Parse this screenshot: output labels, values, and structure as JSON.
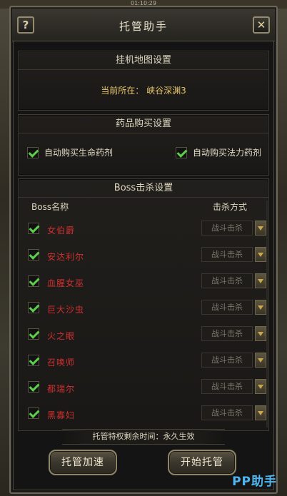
{
  "status": {
    "time": "01:10:29"
  },
  "header": {
    "title": "托管助手",
    "help_label": "?",
    "close_label": "✕"
  },
  "map_section": {
    "title": "挂机地图设置",
    "current_label": "当前所在：",
    "current_map": "峡谷深渊3"
  },
  "medicine_section": {
    "title": "药品购买设置",
    "options": [
      {
        "label": "自动购买生命药剂",
        "checked": true
      },
      {
        "label": "自动购买法力药剂",
        "checked": true
      }
    ]
  },
  "boss_section": {
    "title": "Boss击杀设置",
    "col_name": "Boss名称",
    "col_method": "击杀方式",
    "bosses": [
      {
        "name": "女伯爵",
        "checked": true,
        "method": "战斗击杀"
      },
      {
        "name": "安达利尔",
        "checked": true,
        "method": "战斗击杀"
      },
      {
        "name": "血腥女巫",
        "checked": true,
        "method": "战斗击杀"
      },
      {
        "name": "巨大沙虫",
        "checked": true,
        "method": "战斗击杀"
      },
      {
        "name": "火之眼",
        "checked": true,
        "method": "战斗击杀"
      },
      {
        "name": "召唤师",
        "checked": true,
        "method": "战斗击杀"
      },
      {
        "name": "都瑞尔",
        "checked": true,
        "method": "战斗击杀"
      },
      {
        "name": "黑寡妇",
        "checked": true,
        "method": "战斗击杀"
      }
    ]
  },
  "privilege": {
    "text": "托管特权剩余时间：永久生效"
  },
  "buttons": {
    "speed_up": "托管加速",
    "start": "开始托管"
  },
  "watermark": "PP助手",
  "colors": {
    "boss_name": "#d03030",
    "accent_gold": "#e6c46b",
    "check_green": "#5cd04a",
    "watermark": "#4fb6f2"
  }
}
